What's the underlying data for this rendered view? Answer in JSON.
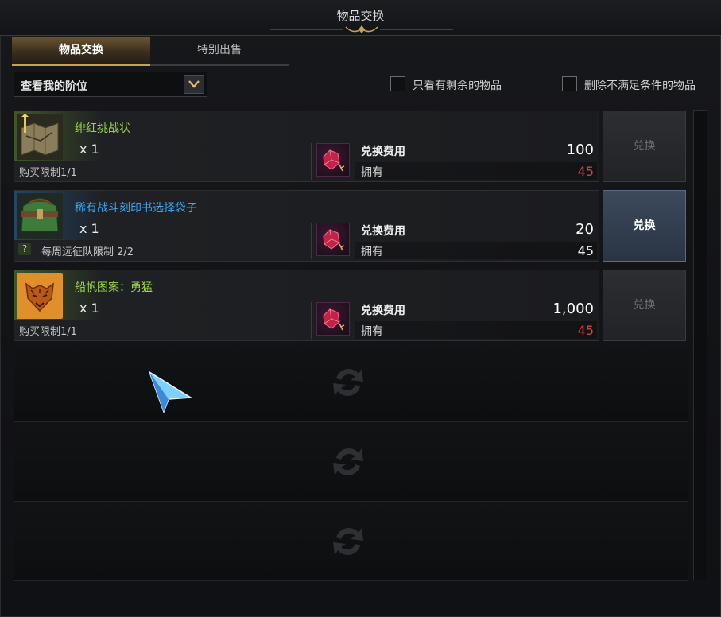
{
  "window": {
    "title": "物品交换"
  },
  "tabs": [
    {
      "label": "物品交换",
      "active": true
    },
    {
      "label": "特别出售",
      "active": false
    }
  ],
  "filter": {
    "dropdown_value": "查看我的阶位",
    "checkbox_remaining": {
      "label": "只看有剩余的物品",
      "checked": false
    },
    "checkbox_unmet": {
      "label": "删除不满足条件的物品",
      "checked": false
    }
  },
  "items": [
    {
      "name": "绯红挑战状",
      "name_color": "#9bd64a",
      "icon": "map-scroll-icon",
      "qty": "x 1",
      "limit": "购买限制1/1",
      "cost_label": "兑换费用",
      "cost": "100",
      "own_label": "拥有",
      "own": "45",
      "own_color": "#e23b3b",
      "button": "兑换",
      "button_enabled": false
    },
    {
      "name": "稀有战斗刻印书选择袋子",
      "name_color": "#3aa4f0",
      "icon": "green-bag-icon",
      "qty": "x 1",
      "limit": "每周远征队限制 2/2",
      "cost_label": "兑换费用",
      "cost": "20",
      "own_label": "拥有",
      "own": "45",
      "own_color": "#e8e8e8",
      "button": "兑换",
      "button_enabled": true
    },
    {
      "name": "船帆图案：勇猛",
      "name_color": "#9bd64a",
      "icon": "tiger-emblem-icon",
      "qty": "x 1",
      "limit": "购买限制1/1",
      "cost_label": "兑换费用",
      "cost": "1,000",
      "own_label": "拥有",
      "own": "45",
      "own_color": "#e23b3b",
      "button": "兑换",
      "button_enabled": false
    }
  ],
  "empty_slots": 3,
  "currency_icon": "crimson-gem-icon",
  "colors": {
    "accent_gold": "#c9a25a",
    "button_blue": "#3c4a5c"
  }
}
